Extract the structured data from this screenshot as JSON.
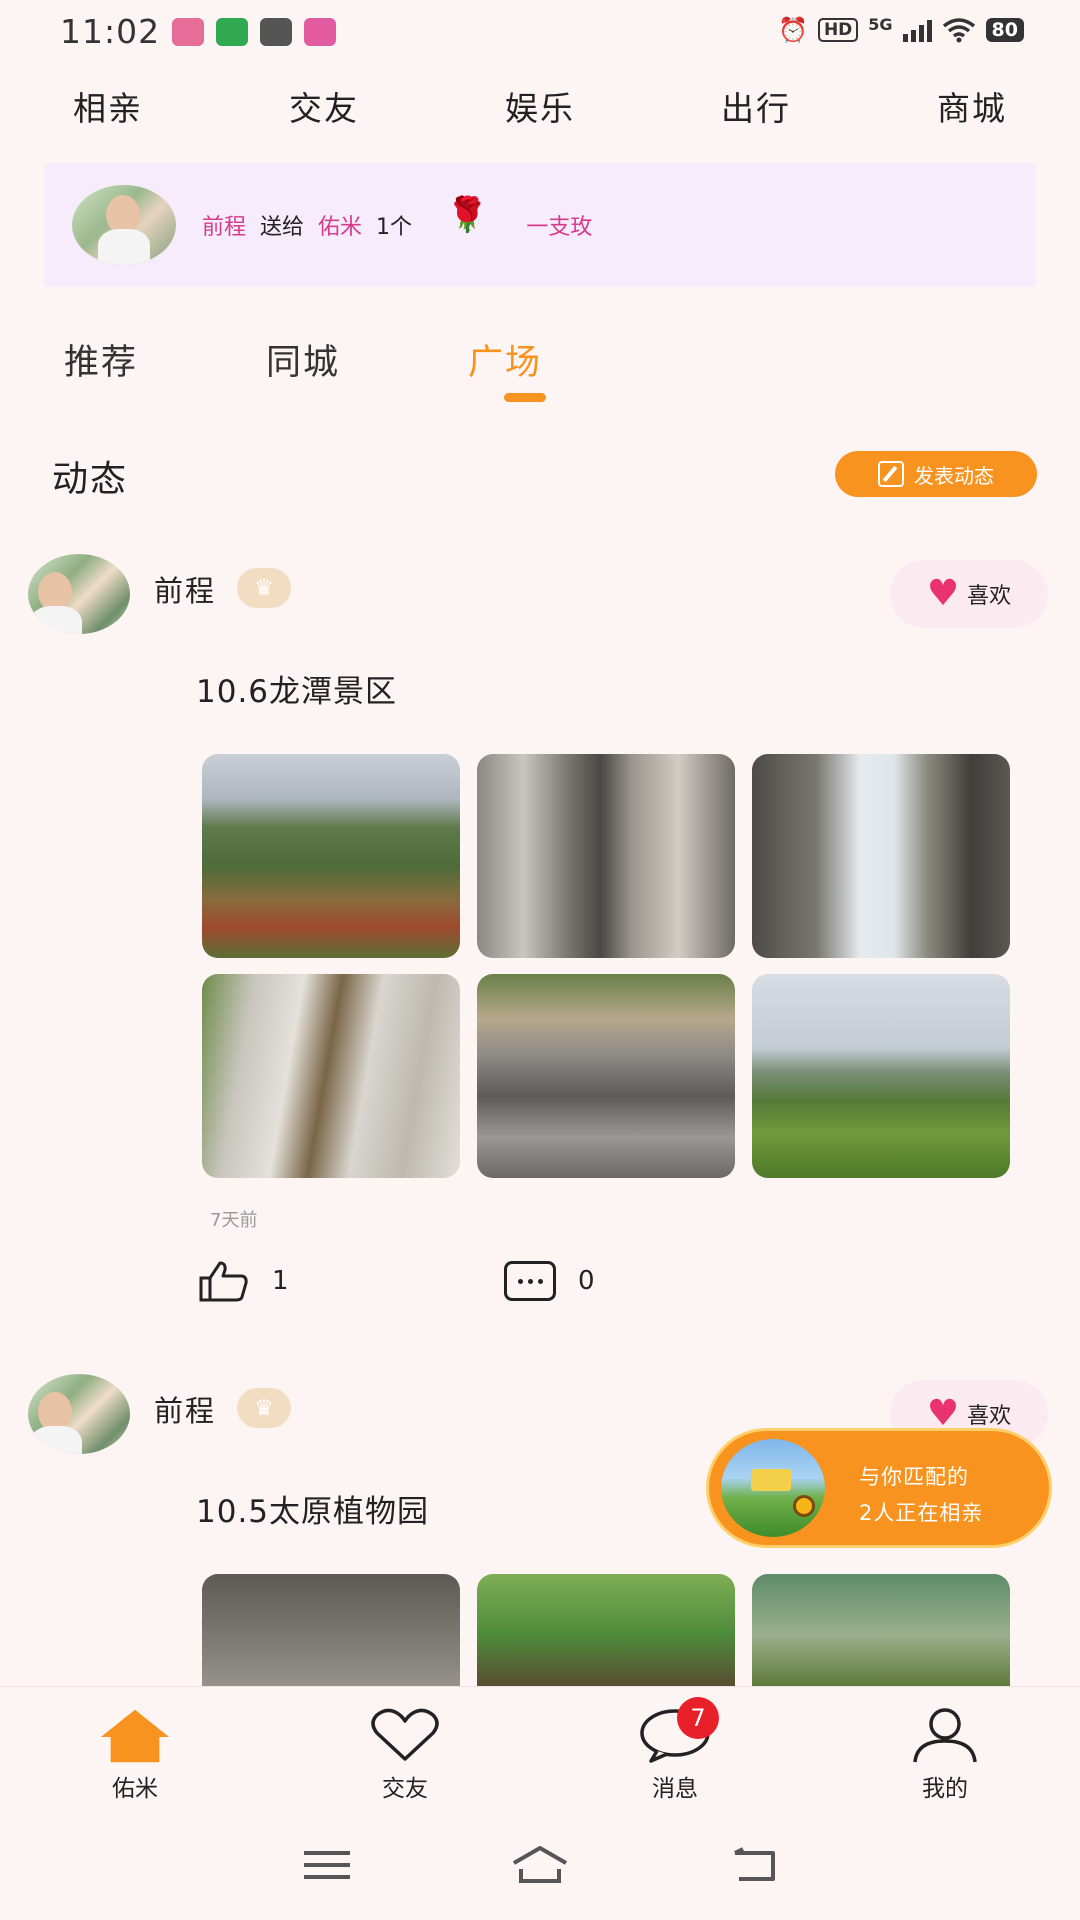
{
  "status_bar": {
    "time": "11:02",
    "hd": "HD",
    "network": "5G",
    "battery": "80"
  },
  "top_nav": [
    "相亲",
    "交友",
    "娱乐",
    "出行",
    "商城"
  ],
  "gift_banner": {
    "sender": "前程",
    "verb": "送给",
    "receiver": "佑米",
    "count": "1个",
    "gift_name": "一支玫"
  },
  "sub_tabs": {
    "items": [
      "推荐",
      "同城",
      "广场"
    ],
    "active": "广场"
  },
  "section": {
    "title": "动态",
    "post_button": "发表动态"
  },
  "posts": [
    {
      "author": "前程",
      "like_label": "喜欢",
      "title": "10.6龙潭景区",
      "time": "7天前",
      "likes": "1",
      "comments": "0",
      "photos": [
        "mountain-forest",
        "canyon-rock-walls",
        "rock-arch",
        "white-rock-gorge",
        "stone-slabs",
        "green-hills"
      ]
    },
    {
      "author": "前程",
      "like_label": "喜欢",
      "title": "10.5太原植物园",
      "photos": [
        "stone-dome",
        "tropical-trees",
        "cactus-greenhouse"
      ]
    }
  ],
  "match_bubble": {
    "line1": "与你匹配的",
    "line2": "2人正在相亲"
  },
  "tab_bar": [
    {
      "label": "佑米",
      "icon": "home-icon",
      "active": true
    },
    {
      "label": "交友",
      "icon": "heart-outline-icon"
    },
    {
      "label": "消息",
      "icon": "chat-icon",
      "badge": "7"
    },
    {
      "label": "我的",
      "icon": "person-icon"
    }
  ],
  "colors": {
    "accent": "#f7931e",
    "pink_text": "#d63b8e",
    "background": "#fdf4f4",
    "badge": "#e8202a"
  }
}
